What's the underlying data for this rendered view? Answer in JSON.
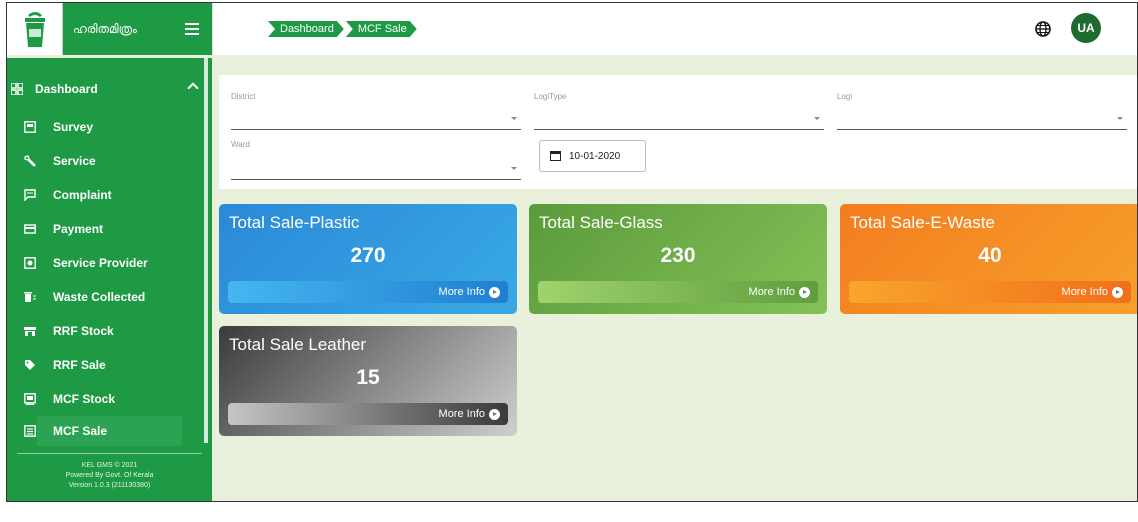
{
  "brand": {
    "name": "ഹരിതമിത്രം"
  },
  "breadcrumb": [
    "Dashboard",
    "MCF Sale"
  ],
  "user": {
    "initials": "UA"
  },
  "sidebar": {
    "dashboard_label": "Dashboard",
    "items": [
      {
        "label": "Survey",
        "icon": "survey-icon"
      },
      {
        "label": "Service",
        "icon": "wrench-icon"
      },
      {
        "label": "Complaint",
        "icon": "chat-icon"
      },
      {
        "label": "Payment",
        "icon": "card-icon"
      },
      {
        "label": "Service Provider",
        "icon": "provider-icon"
      },
      {
        "label": "Waste Collected",
        "icon": "bin-icon"
      },
      {
        "label": "RRF Stock",
        "icon": "store-icon"
      },
      {
        "label": "RRF Sale",
        "icon": "tag-icon"
      },
      {
        "label": "MCF Stock",
        "icon": "stock-icon"
      },
      {
        "label": "MCF Sale",
        "icon": "sale-icon",
        "active": true
      }
    ],
    "footer": [
      "KEL GMS © 2021",
      "Powered By Govt. Of Kerala",
      "Version 1.0.3 (211130380)"
    ]
  },
  "filters": {
    "district_label": "District",
    "logi_type_label": "LogiType",
    "logi_label": "Logi",
    "ward_label": "Ward",
    "date_value": "10-01-2020"
  },
  "cards": [
    {
      "title": "Total Sale-Plastic",
      "value": "270",
      "more": "More Info"
    },
    {
      "title": "Total Sale-Glass",
      "value": "230",
      "more": "More Info"
    },
    {
      "title": "Total Sale-E-Waste",
      "value": "40",
      "more": "More Info"
    },
    {
      "title": "Total Sale Leather",
      "value": "15",
      "more": "More Info"
    }
  ],
  "colors": {
    "primary_green": "#1e9a45",
    "avatar": "#1e6b2f",
    "plastic": "#2b89d8",
    "glass": "#6aa845",
    "ewaste": "#f38a24",
    "leather": "#5a5a5a"
  }
}
